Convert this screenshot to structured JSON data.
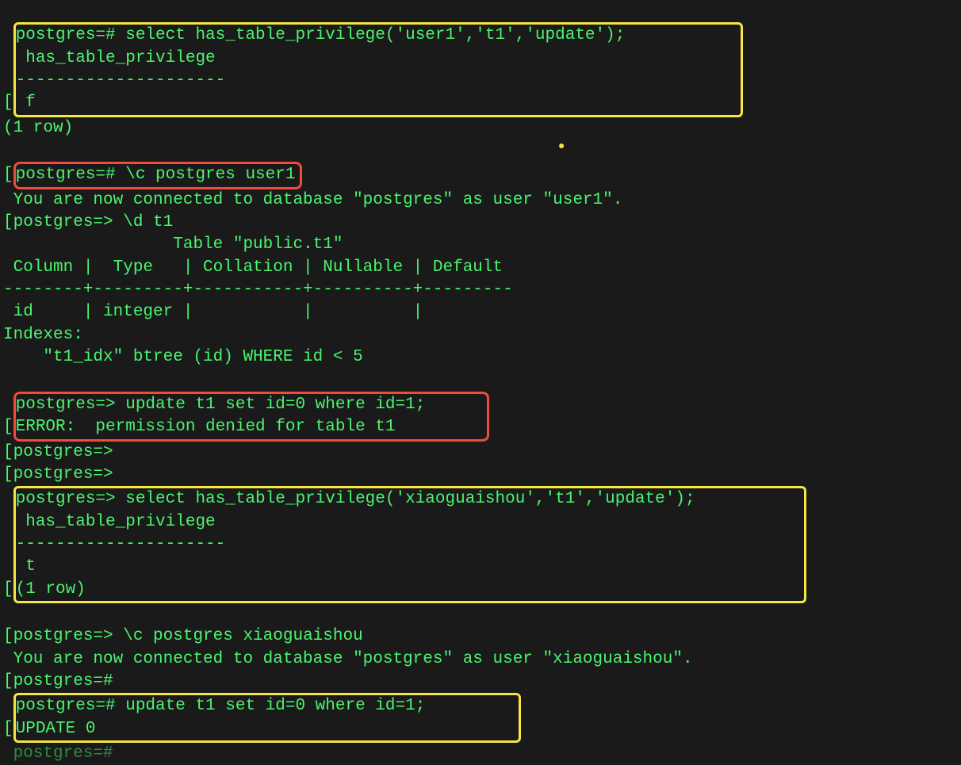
{
  "l1_bracket": "[",
  "l1_text": "postgres=# select has_table_privilege('user1','t1','update');",
  "l2": " has_table_privilege",
  "l3": "---------------------",
  "l4": " f",
  "l5": "(1 row)",
  "blank": "",
  "l6_bracket": "[",
  "l6_text": "postgres=# \\c postgres user1",
  "l7": " You are now connected to database \"postgres\" as user \"user1\".",
  "l8_bracket": "[",
  "l8_text": "postgres=> \\d t1",
  "l9": "                 Table \"public.t1\"",
  "l10": " Column |  Type   | Collation | Nullable | Default",
  "l11": "--------+---------+-----------+----------+---------",
  "l12": " id     | integer |           |          |",
  "l13": "Indexes:",
  "l14": "    \"t1_idx\" btree (id) WHERE id < 5",
  "l15_bracket": "[",
  "l15a": "postgres=> update t1 set id=0 where id=1;",
  "l15b": "ERROR:  permission denied for table t1",
  "l16_bracket": "[",
  "l16_text": "postgres=>",
  "l17_bracket": "[",
  "l17_text": "postgres=>",
  "l18_bracket": "[",
  "l18a": "postgres=> select has_table_privilege('xiaoguaishou','t1','update');",
  "l18b": " has_table_privilege",
  "l18c": "---------------------",
  "l18d": " t",
  "l18e": "(1 row)",
  "l19_bracket": "[",
  "l19_text": "postgres=> \\c postgres xiaoguaishou",
  "l20": " You are now connected to database \"postgres\" as user \"xiaoguaishou\".",
  "l21_bracket": "[",
  "l21_text": "postgres=#",
  "l22_bracket": "[",
  "l22a": "postgres=# update t1 set id=0 where id=1;",
  "l22b": "UPDATE 0",
  "l23": " postgres=#"
}
